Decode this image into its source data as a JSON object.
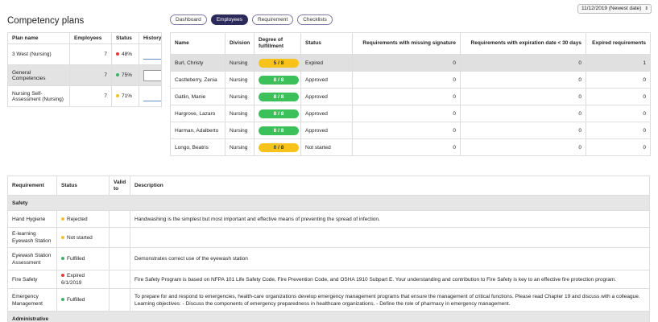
{
  "title": "Competency plans",
  "date_select": {
    "value": "11/12/2019 (Newest date)",
    "arrow": "⇕"
  },
  "tabs": [
    {
      "label": "Dashboard",
      "active": false
    },
    {
      "label": "Employees",
      "active": true
    },
    {
      "label": "Requirement",
      "active": false
    },
    {
      "label": "Checklists",
      "active": false
    }
  ],
  "plans": {
    "headers": {
      "name": "Plan name",
      "employees": "Employees",
      "status": "Status",
      "history": "History"
    },
    "rows": [
      {
        "name": "3 West (Nursing)",
        "employees": "7",
        "status": "48%",
        "status_color": "#e23a3a"
      },
      {
        "name": "General Competencies",
        "employees": "7",
        "status": "75%",
        "status_color": "#3cb36a"
      },
      {
        "name": "Nursing Self-Assessment (Nursing)",
        "employees": "7",
        "status": "71%",
        "status_color": "#f2c12a"
      }
    ]
  },
  "employees": {
    "headers": {
      "name": "Name",
      "division": "Division",
      "degree": "Degree of fulfillment",
      "status": "Status",
      "missing_signature": "Requirements with missing signature",
      "expiration": "Requirements with expiration date < 30 days",
      "expired": "Expired requirements"
    },
    "rows": [
      {
        "name": "Burl, Christy",
        "division": "Nursing",
        "degree": "5 / 8",
        "degree_color": "yellow",
        "status": "Expired",
        "missing": "0",
        "expiring": "0",
        "expired": "1"
      },
      {
        "name": "Castleberry, Zenia",
        "division": "Nursing",
        "degree": "8 / 8",
        "degree_color": "green",
        "status": "Approved",
        "missing": "0",
        "expiring": "0",
        "expired": "0"
      },
      {
        "name": "Gatlin, Manie",
        "division": "Nursing",
        "degree": "8 / 8",
        "degree_color": "green",
        "status": "Approved",
        "missing": "0",
        "expiring": "0",
        "expired": "0"
      },
      {
        "name": "Hargrove, Lazaro",
        "division": "Nursing",
        "degree": "8 / 8",
        "degree_color": "green",
        "status": "Approved",
        "missing": "0",
        "expiring": "0",
        "expired": "0"
      },
      {
        "name": "Harman, Adalberto",
        "division": "Nursing",
        "degree": "8 / 8",
        "degree_color": "green",
        "status": "Approved",
        "missing": "0",
        "expiring": "0",
        "expired": "0"
      },
      {
        "name": "Longo, Beatris",
        "division": "Nursing",
        "degree": "0 / 8",
        "degree_color": "yellow",
        "status": "Not started",
        "missing": "0",
        "expiring": "0",
        "expired": "0"
      }
    ]
  },
  "requirements": {
    "headers": {
      "requirement": "Requirement",
      "status": "Status",
      "valid_to": "Valid to",
      "description": "Description"
    },
    "group_safety": "Safety",
    "group_admin": "Administrative",
    "rows": [
      {
        "requirement": "Hand Hygiene",
        "status": "Rejected",
        "status_color": "#f2c12a",
        "valid_to": "",
        "description": "Handwashing is the simplest but most important and effective means of preventing the spread of infection."
      },
      {
        "requirement": "E-learning Eyewash Station",
        "status": "Not started",
        "status_color": "#f2c12a",
        "valid_to": "",
        "description": ""
      },
      {
        "requirement": "Eyewash Station Assessment",
        "status": "Fulfilled",
        "status_color": "#3cb36a",
        "valid_to": "",
        "description": "Demonstrates correct use of the eyewash station"
      },
      {
        "requirement": "Fire Safety",
        "status": "Expired 6/1/2019",
        "status_color": "#e23a3a",
        "valid_to": "",
        "description": "Fire Safety Program is based on NFPA 101 Life Safety Code, Fire Prevention Code, and OSHA 1910 Subpart E. Your understanding and contribution to Fire Safety is key to an effective fire protection program."
      },
      {
        "requirement": "Emergency Management",
        "status": "Fulfilled",
        "status_color": "#3cb36a",
        "valid_to": "",
        "description": "To prepare for and respond to emergencies, health-care organizations develop emergency management programs that ensure the management of critical functions. Please read Chapter 19 and discuss with a colleague. Learning objectives: - Discuss the components of emergency preparedness in healthcare organizations. - Define the role of pharmacy in emergency management."
      }
    ]
  }
}
